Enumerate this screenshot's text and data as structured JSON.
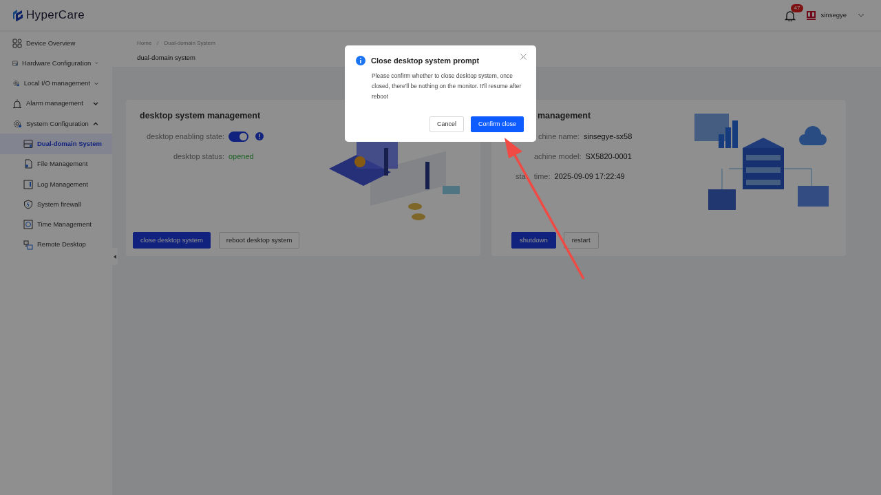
{
  "header": {
    "logo": "HyperCare",
    "notifications": "47",
    "user": "sinsegye"
  },
  "sidebar": {
    "items": [
      {
        "label": "Device Overview",
        "kind": "link"
      },
      {
        "label": "Hardware Configuration",
        "kind": "group",
        "expanded": false
      },
      {
        "label": "Local I/O management",
        "kind": "group",
        "expanded": false
      },
      {
        "label": "Alarm management",
        "kind": "group",
        "expanded": false
      },
      {
        "label": "System Configuration",
        "kind": "group",
        "expanded": true,
        "children": [
          {
            "label": "Dual-domain System",
            "selected": true
          },
          {
            "label": "File Management",
            "selected": false
          },
          {
            "label": "Log Management",
            "selected": false
          },
          {
            "label": "System firewall",
            "selected": false
          },
          {
            "label": "Time Management",
            "selected": false
          },
          {
            "label": "Remote Desktop",
            "selected": false
          }
        ]
      }
    ]
  },
  "breadcrumb": [
    "Home",
    "Dual-domain System"
  ],
  "breadcrumb_separator": "/",
  "page_title": "dual-domain system",
  "cards": [
    {
      "title": "desktop system management",
      "fields": [
        {
          "kind": "switch",
          "label": "desktop enabling state:",
          "on": true
        },
        {
          "kind": "status",
          "label": "desktop status:",
          "value": "opened"
        }
      ],
      "buttons": [
        {
          "label": "close desktop system",
          "primary": true
        },
        {
          "label": "reboot desktop system",
          "primary": false
        }
      ]
    },
    {
      "title": "management",
      "fields": [
        {
          "kind": "text",
          "label": "chine name:",
          "value": "sinsegye-sx58"
        },
        {
          "kind": "text",
          "label": "achine model:",
          "value": "SX5820-0001"
        },
        {
          "kind": "split",
          "label": "sta",
          "label_rest": "time:",
          "value": "2025-09-09 17:22:49"
        }
      ],
      "buttons": [
        {
          "label": "shutdown",
          "primary": true
        },
        {
          "label": "restart",
          "primary": false
        }
      ]
    }
  ],
  "modal": {
    "title": "Close desktop system prompt",
    "message": "Please confirm whether to close desktop system, once closed, there'll be nothing on the monitor. It'll resume after reboot",
    "buttons": [
      {
        "label": "Cancel",
        "primary": false
      },
      {
        "label": "Confirm close",
        "primary": true
      }
    ]
  }
}
